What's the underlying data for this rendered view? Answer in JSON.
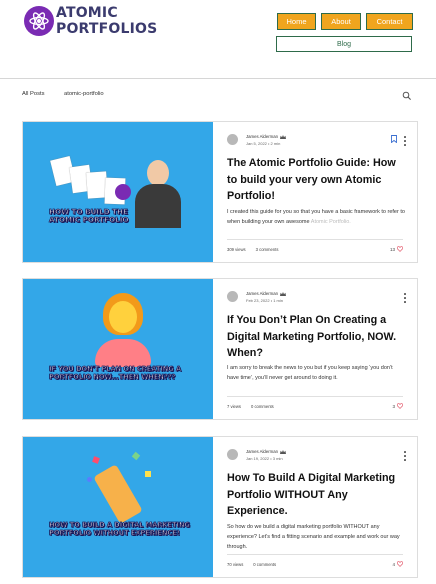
{
  "header": {
    "logo_line1": "ATOMIC",
    "logo_line2": "PORTFOLIOS",
    "nav": {
      "home": "Home",
      "about": "About",
      "contact": "Contact",
      "blog": "Blog"
    }
  },
  "categories": {
    "all": "All Posts",
    "atomic": "atomic-portfolio"
  },
  "colors": {
    "nav_bg": "#f0a51e",
    "nav_border": "#2e6b4a",
    "card_image_bg": "#33a7e8",
    "like_heart": "#e0475b",
    "logo_purple": "#7a2bb3"
  },
  "posts": [
    {
      "author": "James Alderman",
      "date": "Jan 5, 2022",
      "read_time": "2 min",
      "title": "The Atomic Portfolio Guide: How to build your very own Atomic Portfolio!",
      "excerpt": "I created this guide for you so that you have a basic framework to refer to when building your own awesome",
      "excerpt_fade": "Atomic Portfolio.",
      "views": "309 views",
      "comments": "3 comments",
      "likes": "13",
      "image_caption": "HOW TO BUILD THE ATOMIC PORTFOLIO"
    },
    {
      "author": "James Alderman",
      "date": "Feb 23, 2022",
      "read_time": "1 min",
      "title": "If You Don’t Plan On Creating a Digital Marketing Portfolio, NOW. When?",
      "excerpt": "I am sorry to break the news to you but if you keep saying ‘you don’t have time’, you’ll never get around to doing it.",
      "excerpt_fade": "",
      "views": "7 views",
      "comments": "0 comments",
      "likes": "3",
      "image_caption": "IF YOU DON'T PLAN ON CREATING A PORTFOLIO NOW...THEN WHEN???"
    },
    {
      "author": "James Alderman",
      "date": "Jan 19, 2022",
      "read_time": "3 min",
      "title": "How To Build A Digital Marketing Portfolio WITHOUT Any Experience.",
      "excerpt": "So how do we build a digital marketing portfolio WITHOUT any experience? Let’s find a fitting scenario and example and work our way through.",
      "excerpt_fade": "",
      "views": "70 views",
      "comments": "0 comments",
      "likes": "4",
      "image_caption": "HOW TO BUILD A DIGITAL MARKETING PORTFOLIO WITHOUT EXPERIENCE!"
    }
  ]
}
